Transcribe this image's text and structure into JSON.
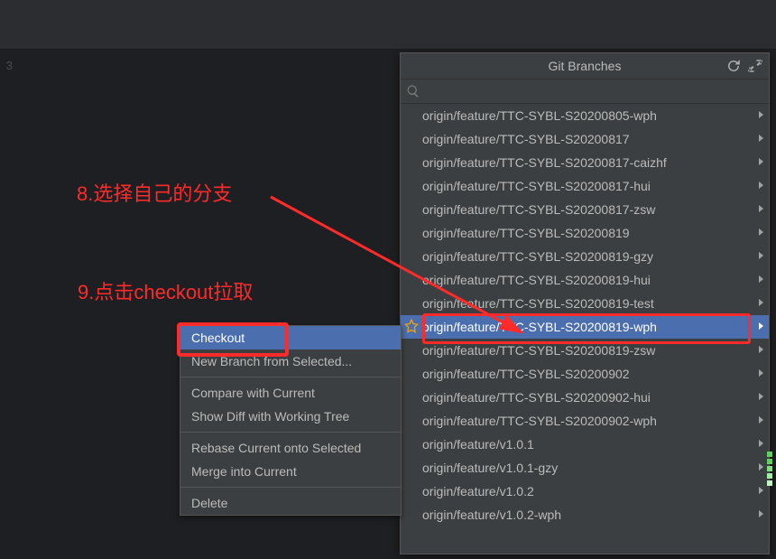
{
  "git_popup": {
    "title": "Git Branches",
    "search_placeholder": "",
    "branches": [
      {
        "label": "origin/feature/TTC-SYBL-S20200805-wph"
      },
      {
        "label": "origin/feature/TTC-SYBL-S20200817"
      },
      {
        "label": "origin/feature/TTC-SYBL-S20200817-caizhf"
      },
      {
        "label": "origin/feature/TTC-SYBL-S20200817-hui"
      },
      {
        "label": "origin/feature/TTC-SYBL-S20200817-zsw"
      },
      {
        "label": "origin/feature/TTC-SYBL-S20200819"
      },
      {
        "label": "origin/feature/TTC-SYBL-S20200819-gzy"
      },
      {
        "label": "origin/feature/TTC-SYBL-S20200819-hui"
      },
      {
        "label": "origin/feature/TTC-SYBL-S20200819-test"
      },
      {
        "label": "origin/feature/TTC-SYBL-S20200819-wph",
        "selected": true,
        "starred": true,
        "boxed": true
      },
      {
        "label": "origin/feature/TTC-SYBL-S20200819-zsw"
      },
      {
        "label": "origin/feature/TTC-SYBL-S20200902"
      },
      {
        "label": "origin/feature/TTC-SYBL-S20200902-hui"
      },
      {
        "label": "origin/feature/TTC-SYBL-S20200902-wph"
      },
      {
        "label": "origin/feature/v1.0.1"
      },
      {
        "label": "origin/feature/v1.0.1-gzy"
      },
      {
        "label": "origin/feature/v1.0.2"
      },
      {
        "label": "origin/feature/v1.0.2-wph"
      }
    ]
  },
  "context_menu": {
    "items": [
      {
        "label": "Checkout",
        "selected": true,
        "boxed": true
      },
      {
        "label": "New Branch from Selected..."
      },
      {
        "sep": true
      },
      {
        "label": "Compare with Current"
      },
      {
        "label": "Show Diff with Working Tree"
      },
      {
        "sep": true
      },
      {
        "label": "Rebase Current onto Selected"
      },
      {
        "label": "Merge into Current"
      },
      {
        "sep": true
      },
      {
        "label": "Delete"
      }
    ]
  },
  "annotations": {
    "a8": "8.选择自己的分支",
    "a9": "9.点击checkout拉取"
  },
  "gutter_num": "3",
  "colors": {
    "accent": "#4b6eaf",
    "highlight": "#ff2a2a",
    "star": "#f0a30a"
  }
}
